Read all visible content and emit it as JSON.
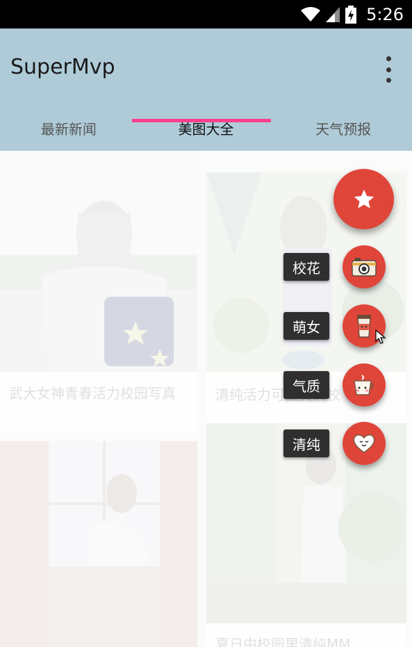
{
  "status_bar": {
    "time": "5:26",
    "icons": [
      "wifi-icon",
      "signal-icon",
      "battery-icon"
    ]
  },
  "app_bar": {
    "title": "SuperMvp",
    "overflow_icon": "more-vert-icon"
  },
  "tabs": [
    {
      "label": "最新新闻",
      "selected": false
    },
    {
      "label": "美图大全",
      "selected": true
    },
    {
      "label": "天气预报",
      "selected": false
    }
  ],
  "cards": [
    {
      "caption": "武大女神青春活力校园写真"
    },
    {
      "caption": "清纯活力可爱美女校"
    },
    {
      "caption": ""
    },
    {
      "caption": "夏日中校园里清纯MM"
    }
  ],
  "fab": {
    "main_icon": "star-icon",
    "items": [
      {
        "label": "校花",
        "icon": "camera-icon"
      },
      {
        "label": "萌女",
        "icon": "coffee-cup-icon"
      },
      {
        "label": "气质",
        "icon": "cute-cup-icon"
      },
      {
        "label": "清纯",
        "icon": "heart-icon"
      }
    ]
  },
  "colors": {
    "app_bar": "#afcbd8",
    "tab_indicator": "#ff3f8e",
    "fab": "#e0453a",
    "fab_label_bg": "#2f2f2f"
  }
}
